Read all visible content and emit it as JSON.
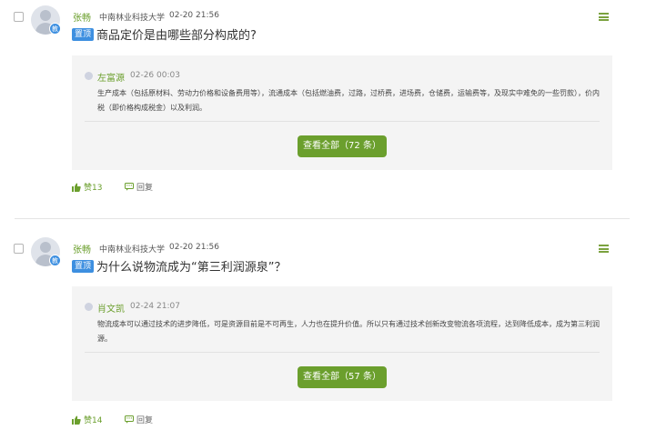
{
  "posts": [
    {
      "author": "张畅",
      "school": "中南林业科技大学",
      "date": "02-20 21:56",
      "badge": "教",
      "pin_label": "置顶",
      "title": "商品定价是由哪些部分构成的?",
      "answer": {
        "author": "左富源",
        "date": "02-26 00:03",
        "text": "生产成本（包括原材料、劳动力价格和设备费用等），流通成本（包括燃油费，过路，过桥费，进场费，仓储费，运输费等，及现实中难免的一些罚款），价内税（即价格构成税金）以及利润。"
      },
      "view_all_label": "查看全部（72 条）",
      "like_label": "赞13",
      "reply_label": "回复"
    },
    {
      "author": "张畅",
      "school": "中南林业科技大学",
      "date": "02-20 21:56",
      "badge": "教",
      "pin_label": "置顶",
      "title": "为什么说物流成为“第三利润源泉”？",
      "answer": {
        "author": "肖文凯",
        "date": "02-24 21:07",
        "text": "物流成本可以通过技术的进步降低，可是资源目前是不可再生，人力也在提升价值。所以只有通过技术创新改变物流各项流程，达到降低成本，成为第三利润源。"
      },
      "view_all_label": "查看全部（57 条）",
      "like_label": "赞14",
      "reply_label": "回复"
    }
  ],
  "colors": {
    "accent": "#6b9f2d",
    "pin": "#3d8fe0",
    "answer_bg": "#f4f4f4"
  },
  "icons": [
    "checkbox",
    "avatar",
    "menu-icon",
    "thumb-up-icon",
    "reply-icon"
  ]
}
